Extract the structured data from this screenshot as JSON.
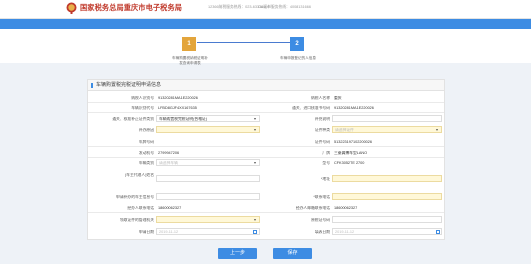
{
  "header": {
    "title": "国家税务总局重庆市电子税务局",
    "phone": "12366纳税服务热线：023-63336666",
    "hotline": "CA证书服务热线：4008131666"
  },
  "steps": [
    {
      "num": "1",
      "label_line1": "车辆购置税纳税证明补",
      "label_line2": "发查询申请表"
    },
    {
      "num": "2",
      "label_line1": "车辆申报登记的人信息",
      "label_line2": ""
    }
  ],
  "form": {
    "title": "车辆购置税完税证明申请信息",
    "fields": [
      {
        "label": "纳税人识别号",
        "value": "91320281MA1E220026"
      },
      {
        "label": "纳税人名称",
        "value": "重庆"
      },
      {
        "label": "车辆识别代号",
        "value": "LFBD8GJF4XX167635"
      },
      {
        "label": "通关、进口核准书号码",
        "value": "91320281MA1E220026"
      },
      {
        "label": "通关、核准补正证件类别",
        "value": "车辆购置税完税证明(合格证)"
      },
      {
        "label": "补充说明",
        "value": ""
      },
      {
        "label": "补办原因",
        "value": ""
      },
      {
        "label": "证件种类",
        "value": "请选择证件"
      },
      {
        "label": "车牌号码",
        "value": ""
      },
      {
        "label": "证件号码",
        "value": "513223197102200026"
      },
      {
        "label": "发动机号",
        "value": "2799947206"
      },
      {
        "label": "厂牌",
        "value": "三菱翼搏车型LANO"
      },
      {
        "label": "车辆类别",
        "value": "请选择车辆"
      },
      {
        "label": "型号",
        "value": "CFK3052TE 2700"
      },
      {
        "label": "(车主代理人)姓名",
        "value": ""
      },
      {
        "label": "*地址",
        "value": ""
      },
      {
        "label": "申请补办的车主信息号",
        "value": ""
      },
      {
        "label": "*联系电话",
        "value": ""
      },
      {
        "label": "经办人联系电话",
        "value": "18600062327"
      },
      {
        "label": "经办人邮箱联系电话",
        "value": "18600062327"
      },
      {
        "label": "领取证件的管理机关",
        "value": ""
      },
      {
        "label": "原税证号码",
        "value": ""
      },
      {
        "label": "申请日期",
        "value": "2019-11-12"
      },
      {
        "label": "填表日期",
        "value": "2019-11-12"
      }
    ]
  },
  "buttons": {
    "prev": "上一步",
    "save": "保存"
  }
}
